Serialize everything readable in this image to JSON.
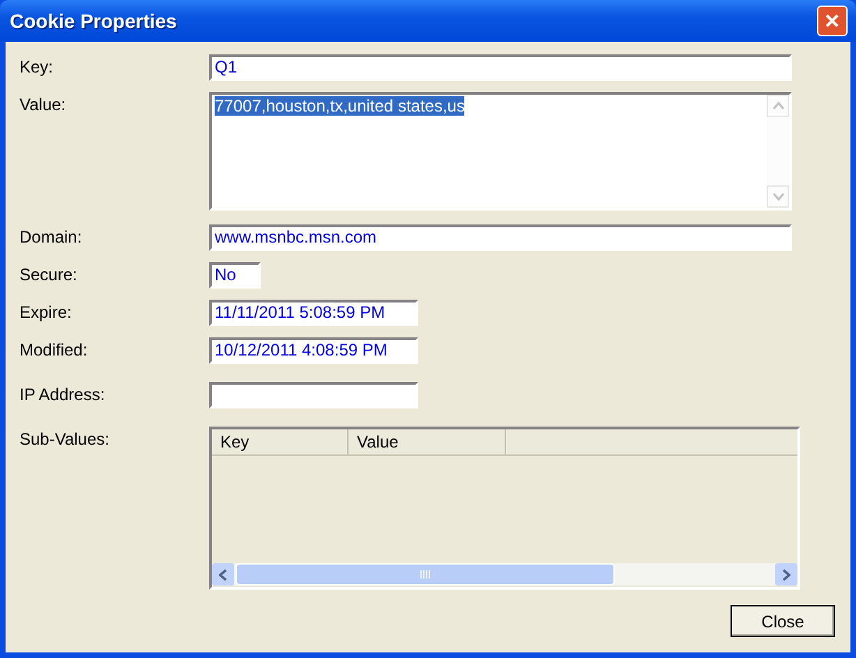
{
  "window": {
    "title": "Cookie Properties",
    "close_glyph": "✕"
  },
  "fields": [
    {
      "label": "Key:",
      "value": "Q1",
      "kind": "wide"
    },
    {
      "label": "Value:",
      "value": "77007,houston,tx,united states,us",
      "kind": "multiline",
      "text_selected": true
    },
    {
      "label": "Domain:",
      "value": "www.msnbc.msn.com",
      "kind": "wide"
    },
    {
      "label": "Secure:",
      "value": "No",
      "kind": "tiny"
    },
    {
      "label": "Expire:",
      "value": "11/11/2011 5:08:59 PM",
      "kind": "medium"
    },
    {
      "label": "Modified:",
      "value": "10/12/2011 4:08:59 PM",
      "kind": "medium"
    },
    {
      "label": "IP Address:",
      "kind": "medium"
    }
  ],
  "sub_values": {
    "label": "Sub-Values:",
    "columns": [
      "Key",
      "Value"
    ]
  },
  "buttons": [
    "Close"
  ]
}
